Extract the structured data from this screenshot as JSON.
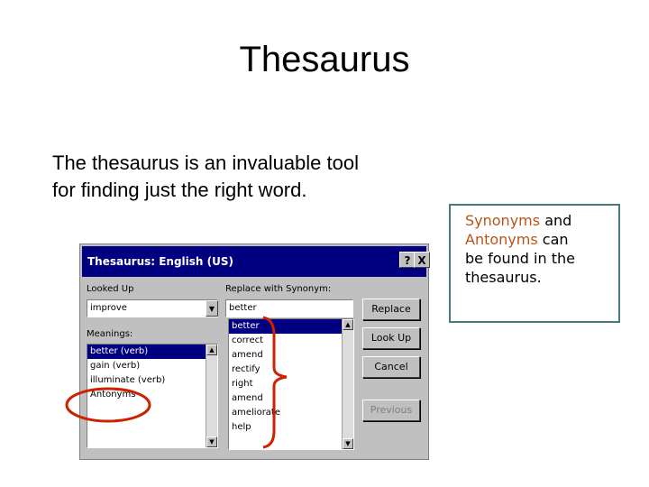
{
  "slide": {
    "title": "Thesaurus",
    "body_line1": "The thesaurus is an invaluable tool",
    "body_line2": "for finding just the right word."
  },
  "callout": {
    "word1": "Synonyms",
    "and": "and",
    "word2": "Antonyms",
    "rest1": "can",
    "rest2": "be found in the",
    "rest3": "thesaurus.",
    "highlight_color": "#b8541a",
    "border_color": "#4a7a7a"
  },
  "dialog": {
    "title": "Thesaurus: English (US)",
    "help_label": "?",
    "close_label": "X",
    "looked_up_label": "Looked Up",
    "looked_up_value": "improve",
    "meanings_label": "Meanings:",
    "meanings": [
      "better (verb)",
      "gain (verb)",
      "illuminate (verb)",
      "Antonyms"
    ],
    "replace_label": "Replace with Synonym:",
    "replace_value": "better",
    "synonyms": [
      "better",
      "correct",
      "amend",
      "rectify",
      "right",
      "amend",
      "ameliorate",
      "help"
    ],
    "buttons": {
      "replace": "Replace",
      "lookup": "Look Up",
      "cancel": "Cancel",
      "previous": "Previous"
    }
  },
  "annotation_color": "#cc2200"
}
